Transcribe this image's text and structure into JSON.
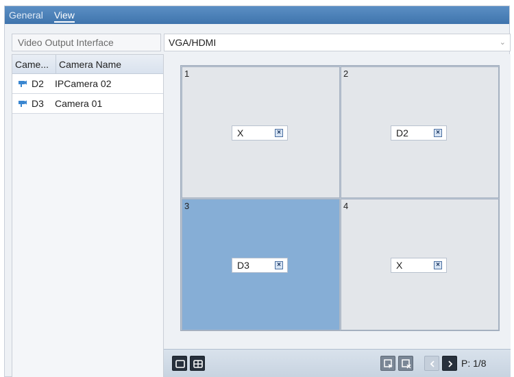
{
  "tabs": [
    {
      "label": "General",
      "active": false
    },
    {
      "label": "View",
      "active": true
    }
  ],
  "video_output": {
    "label": "Video Output Interface",
    "value": "VGA/HDMI"
  },
  "camera_list": {
    "headers": [
      "Came...",
      "Camera Name"
    ],
    "rows": [
      {
        "id": "D2",
        "name": "IPCamera 02",
        "icon": "camera-icon"
      },
      {
        "id": "D3",
        "name": "Camera 01",
        "icon": "camera-icon"
      }
    ]
  },
  "grid": {
    "cells": [
      {
        "number": "1",
        "channel": "X",
        "selected": false
      },
      {
        "number": "2",
        "channel": "D2",
        "selected": false
      },
      {
        "number": "3",
        "channel": "D3",
        "selected": true
      },
      {
        "number": "4",
        "channel": "X",
        "selected": false
      }
    ]
  },
  "toolbar": {
    "page": "P: 1/8",
    "buttons": [
      "single-layout-icon",
      "quad-layout-icon",
      "start-live-view-icon",
      "stop-live-view-icon",
      "prev-page-icon",
      "next-page-icon"
    ]
  },
  "colors": {
    "tab_bar": "#3f74ad",
    "selected_cell": "#86aed6"
  }
}
